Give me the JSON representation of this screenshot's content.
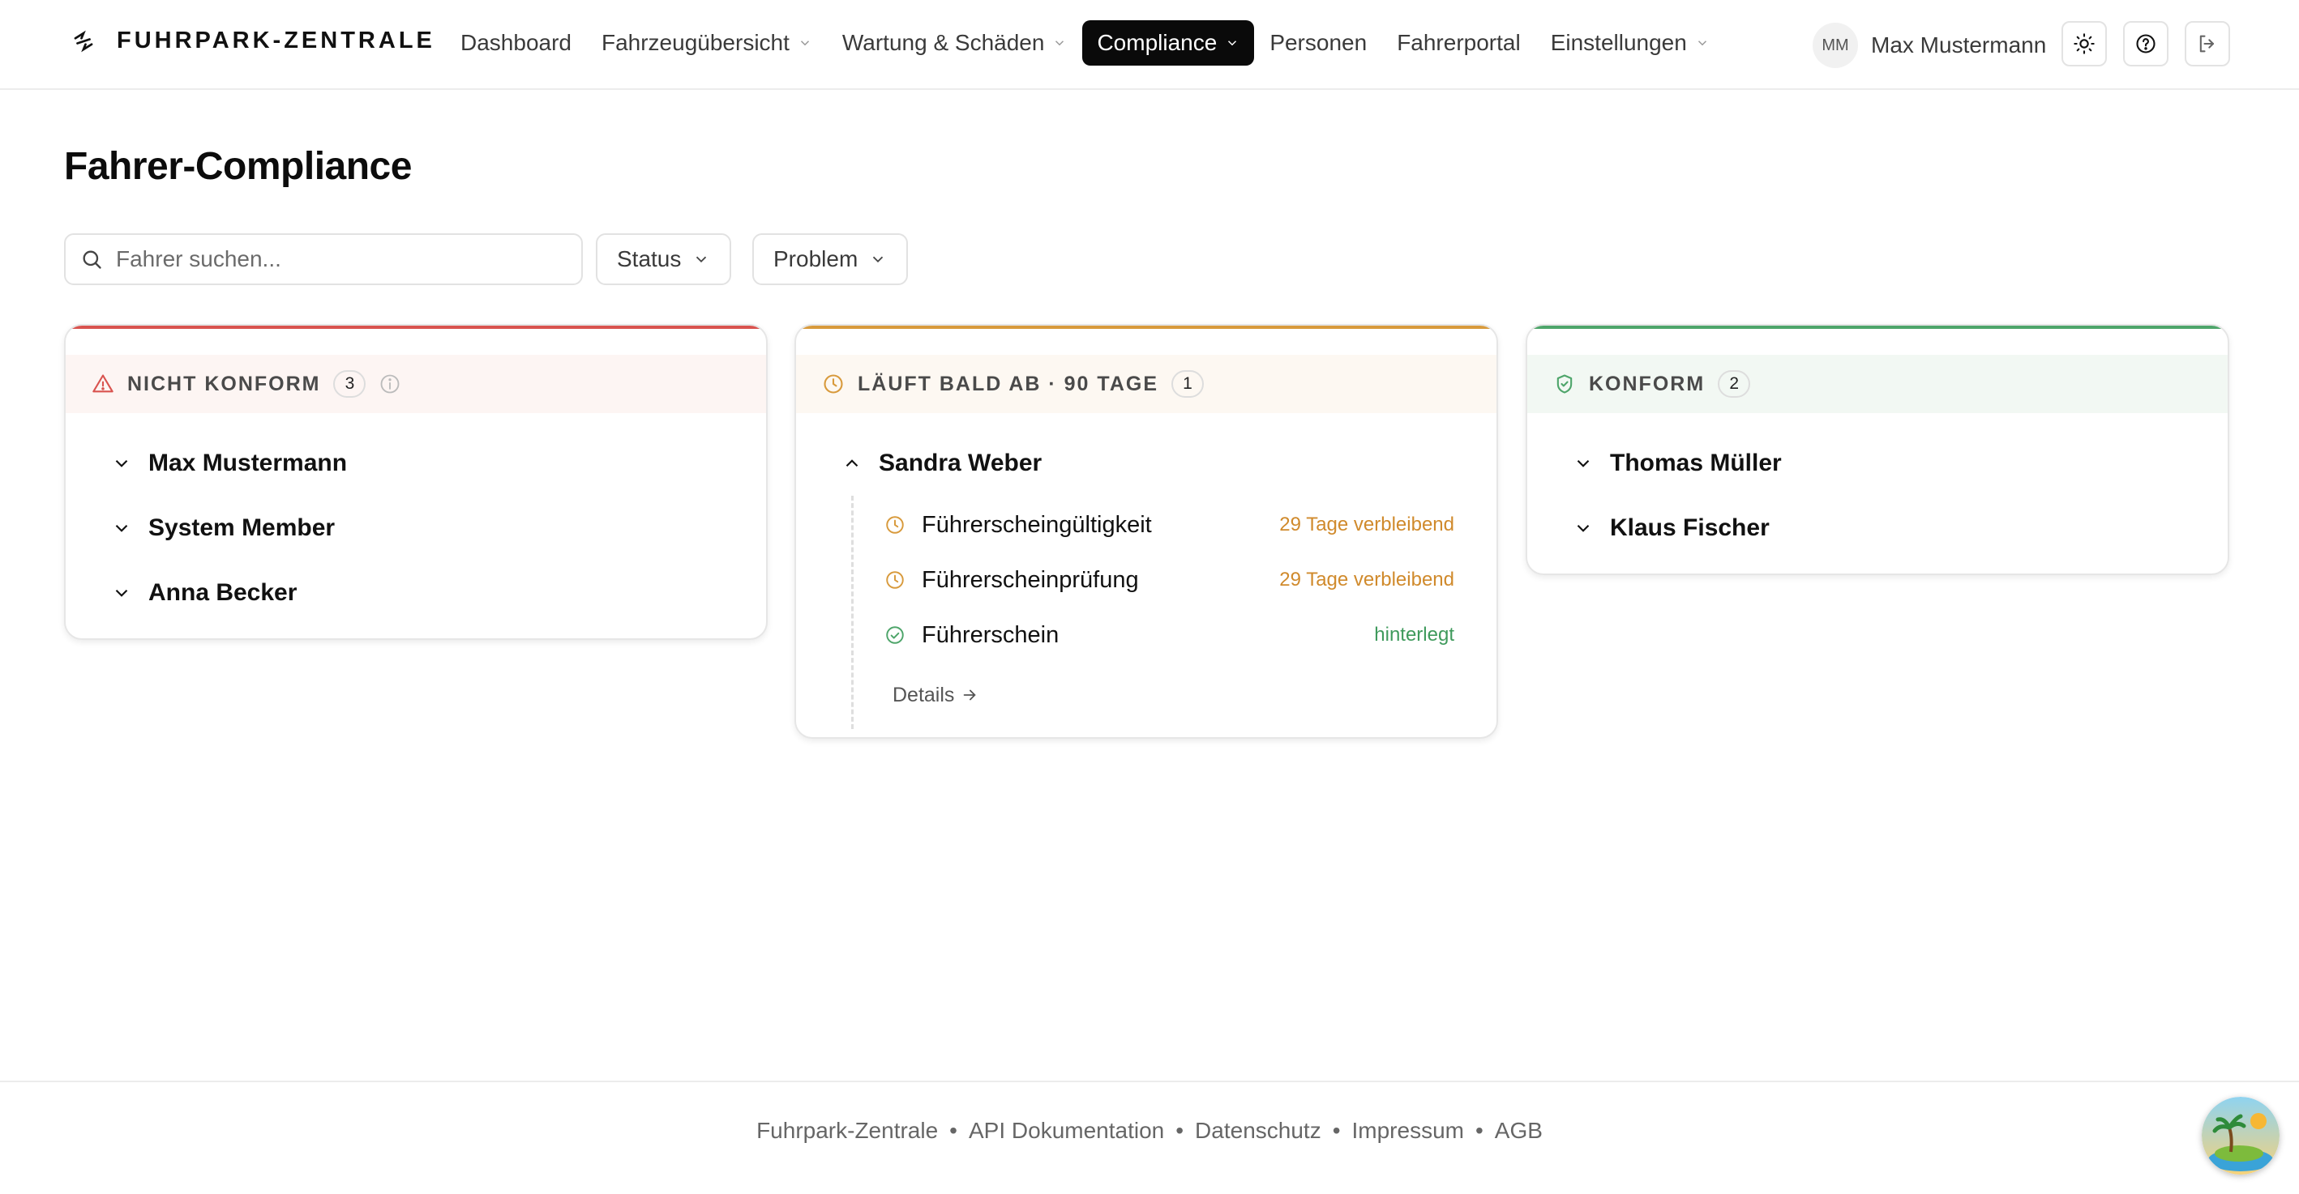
{
  "header": {
    "brand": "FUHRPARK-ZENTRALE",
    "nav": [
      {
        "label": "Dashboard",
        "dropdown": false,
        "active": false
      },
      {
        "label": "Fahrzeugübersicht",
        "dropdown": true,
        "active": false
      },
      {
        "label": "Wartung & Schäden",
        "dropdown": true,
        "active": false
      },
      {
        "label": "Compliance",
        "dropdown": true,
        "active": true
      },
      {
        "label": "Personen",
        "dropdown": false,
        "active": false
      },
      {
        "label": "Fahrerportal",
        "dropdown": false,
        "active": false
      },
      {
        "label": "Einstellungen",
        "dropdown": true,
        "active": false
      }
    ],
    "user": {
      "initials": "MM",
      "name": "Max Mustermann"
    },
    "icons": [
      "sun-icon",
      "help-icon",
      "logout-icon"
    ]
  },
  "page": {
    "title": "Fahrer-Compliance"
  },
  "filters": {
    "search_placeholder": "Fahrer suchen...",
    "status_label": "Status",
    "problem_label": "Problem"
  },
  "columns": [
    {
      "title": "NICHT KONFORM",
      "count": "3",
      "accent": "#d9534f",
      "head_bg": "#fdf5f3",
      "icon": "warning-icon",
      "people": [
        "Max Mustermann",
        "System Member",
        "Anna Becker"
      ]
    },
    {
      "title": "LÄUFT BALD AB · 90 TAGE",
      "count": "1",
      "accent": "#d89a3c",
      "head_bg": "#fdf8f2",
      "icon": "clock-icon",
      "person": "Sandra Weber",
      "items": [
        {
          "label": "Führerscheingültigkeit",
          "status": "29 Tage verbleibend",
          "color": "#d08a2c",
          "icon": "clock-icon"
        },
        {
          "label": "Führerscheinprüfung",
          "status": "29 Tage verbleibend",
          "color": "#d08a2c",
          "icon": "clock-icon"
        },
        {
          "label": "Führerschein",
          "status": "hinterlegt",
          "color": "#3f9a5c",
          "icon": "check-circle-icon"
        }
      ],
      "details": "Details"
    },
    {
      "title": "KONFORM",
      "count": "2",
      "accent": "#4ea56a",
      "head_bg": "#f2f8f3",
      "icon": "shield-check-icon",
      "people": [
        "Thomas Müller",
        "Klaus Fischer"
      ]
    }
  ],
  "footer": {
    "links": [
      "Fuhrpark-Zentrale",
      "API Dokumentation",
      "Datenschutz",
      "Impressum",
      "AGB"
    ]
  }
}
